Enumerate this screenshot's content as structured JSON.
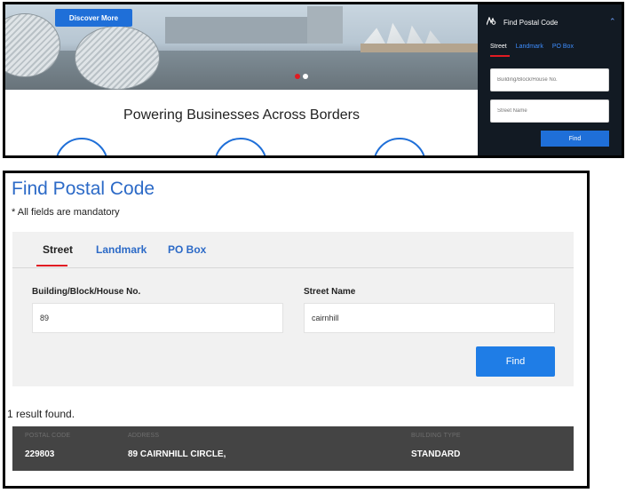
{
  "hero": {
    "cta_label": "Discover More",
    "headline": "Powering Businesses Across Borders"
  },
  "side_widget": {
    "title": "Find Postal Code",
    "icon": "map-search-icon",
    "tabs": [
      {
        "label": "Street",
        "active": true
      },
      {
        "label": "Landmark",
        "active": false
      },
      {
        "label": "PO Box",
        "active": false
      }
    ],
    "building_placeholder": "Building/Block/House No.",
    "street_placeholder": "Street Name",
    "find_label": "Find"
  },
  "form": {
    "title": "Find Postal Code",
    "mandatory_note": "* All fields are mandatory",
    "tabs": [
      {
        "label": "Street",
        "active": true
      },
      {
        "label": "Landmark",
        "active": false
      },
      {
        "label": "PO Box",
        "active": false
      }
    ],
    "building_label": "Building/Block/House No.",
    "building_value": "89",
    "street_label": "Street Name",
    "street_value": "cairnhill",
    "find_label": "Find"
  },
  "results": {
    "count_text": "1 result found.",
    "columns": [
      "POSTAL CODE",
      "ADDRESS",
      "BUILDING TYPE"
    ],
    "rows": [
      [
        "229803",
        "89 CAIRNHILL CIRCLE,",
        "STANDARD"
      ]
    ]
  },
  "colors": {
    "accent_blue": "#1f7de6",
    "title_blue": "#2c6ac7",
    "active_underline": "#e11b22",
    "sidebar_bg": "#121a23",
    "table_bg": "#444444"
  }
}
